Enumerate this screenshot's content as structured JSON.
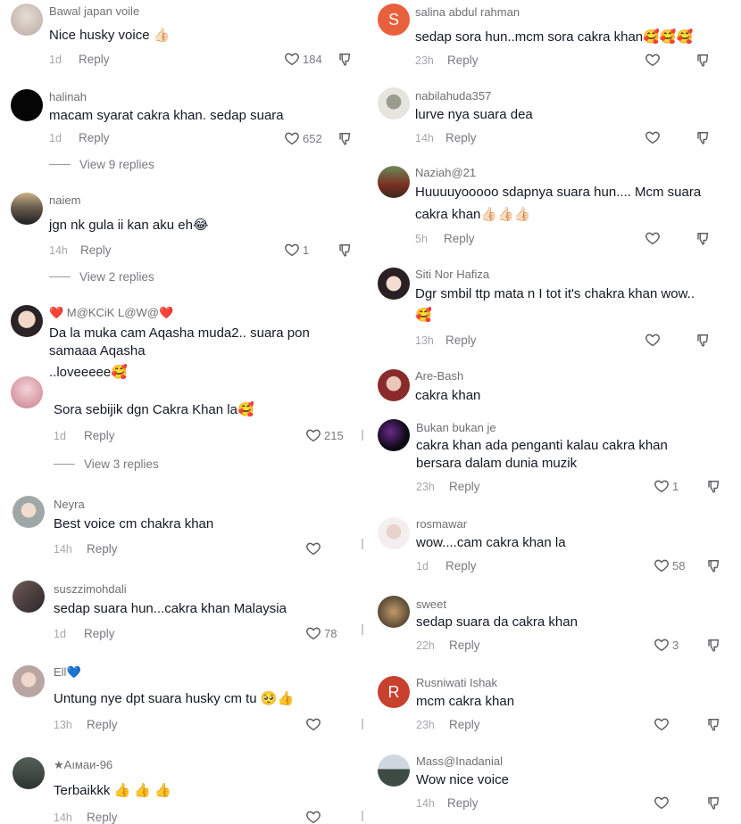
{
  "left": [
    {
      "user": "Bawal japan voile",
      "text": "Nice husky voice 👍🏻",
      "time": "1d",
      "reply": "Reply",
      "likes": "184"
    },
    {
      "user": "halinah",
      "text": "macam syarat cakra khan. sedap suara",
      "time": "1d",
      "reply": "Reply",
      "likes": "652",
      "view_replies": "View 9 replies"
    },
    {
      "user": "naiem",
      "text": "jgn nk gula ii kan aku eh😂",
      "time": "14h",
      "reply": "Reply",
      "likes": "1",
      "view_replies": "View 2 replies"
    },
    {
      "user": "❤️ M@KCiK L@W@❤️",
      "text": "Da la muka cam Aqasha muda2.. suara pon",
      "text2": "samaaa Aqasha",
      "text3": "..loveeeee🥰"
    },
    {
      "user": "",
      "text": "Sora sebijik dgn Cakra Khan la🥰",
      "time": "1d",
      "reply": "Reply",
      "likes": "215",
      "view_replies": "View 3 replies"
    },
    {
      "user": "Neyra",
      "text": "Best voice cm chakra khan",
      "time": "14h",
      "reply": "Reply",
      "likes": ""
    },
    {
      "user": "suszzimohdali",
      "text": "sedap suara hun...cakra khan Malaysia",
      "time": "1d",
      "reply": "Reply",
      "likes": "78"
    },
    {
      "user": "Ell💙",
      "text": "Untung nye dpt suara husky cm tu 🥺👍",
      "time": "13h",
      "reply": "Reply",
      "likes": ""
    },
    {
      "user": "★Aıмaи-96",
      "text": "Terbaikkk 👍 👍 👍",
      "time": "14h",
      "reply": "Reply",
      "likes": ""
    }
  ],
  "right": [
    {
      "user": "salina abdul rahman",
      "avatar_letter": "S",
      "text": "sedap sora hun..mcm sora cakra khan🥰🥰🥰",
      "time": "23h",
      "reply": "Reply",
      "likes": ""
    },
    {
      "user": "nabilahuda357",
      "text": "lurve nya suara dea",
      "time": "14h",
      "reply": "Reply",
      "likes": ""
    },
    {
      "user": "Naziah@21",
      "text": "Huuuuyooooo sdapnya suara hun.... Mcm suara",
      "text2": "cakra khan👍🏻👍🏻👍🏻",
      "time": "5h",
      "reply": "Reply",
      "likes": ""
    },
    {
      "user": "Siti Nor Hafiza",
      "text": "Dgr smbil ttp mata n I tot it's chakra khan wow..",
      "text2": "🥰",
      "time": "13h",
      "reply": "Reply",
      "likes": ""
    },
    {
      "user": "Are-Bash",
      "text": "cakra khan"
    },
    {
      "user": "Bukan bukan je",
      "text": "cakra khan ada penganti kalau cakra khan",
      "text2": "bersara dalam dunia muzik",
      "time": "23h",
      "reply": "Reply",
      "likes": "1"
    },
    {
      "user": "rosmawar",
      "text": "wow....cam cakra khan la",
      "time": "1d",
      "reply": "Reply",
      "likes": "58"
    },
    {
      "user": "sweet",
      "text": "sedap suara da cakra khan",
      "time": "22h",
      "reply": "Reply",
      "likes": "3"
    },
    {
      "user": "Rusniwati Ishak",
      "avatar_letter": "R",
      "text": "mcm cakra khan",
      "time": "23h",
      "reply": "Reply",
      "likes": ""
    },
    {
      "user": "Mass@Inadanial",
      "text": "Wow nice voice",
      "time": "14h",
      "reply": "Reply",
      "likes": ""
    }
  ],
  "colors": {
    "text": "#161823",
    "muted": "#7a7a7e",
    "avatar_s": "#e8603c",
    "avatar_r": "#c8402e"
  }
}
